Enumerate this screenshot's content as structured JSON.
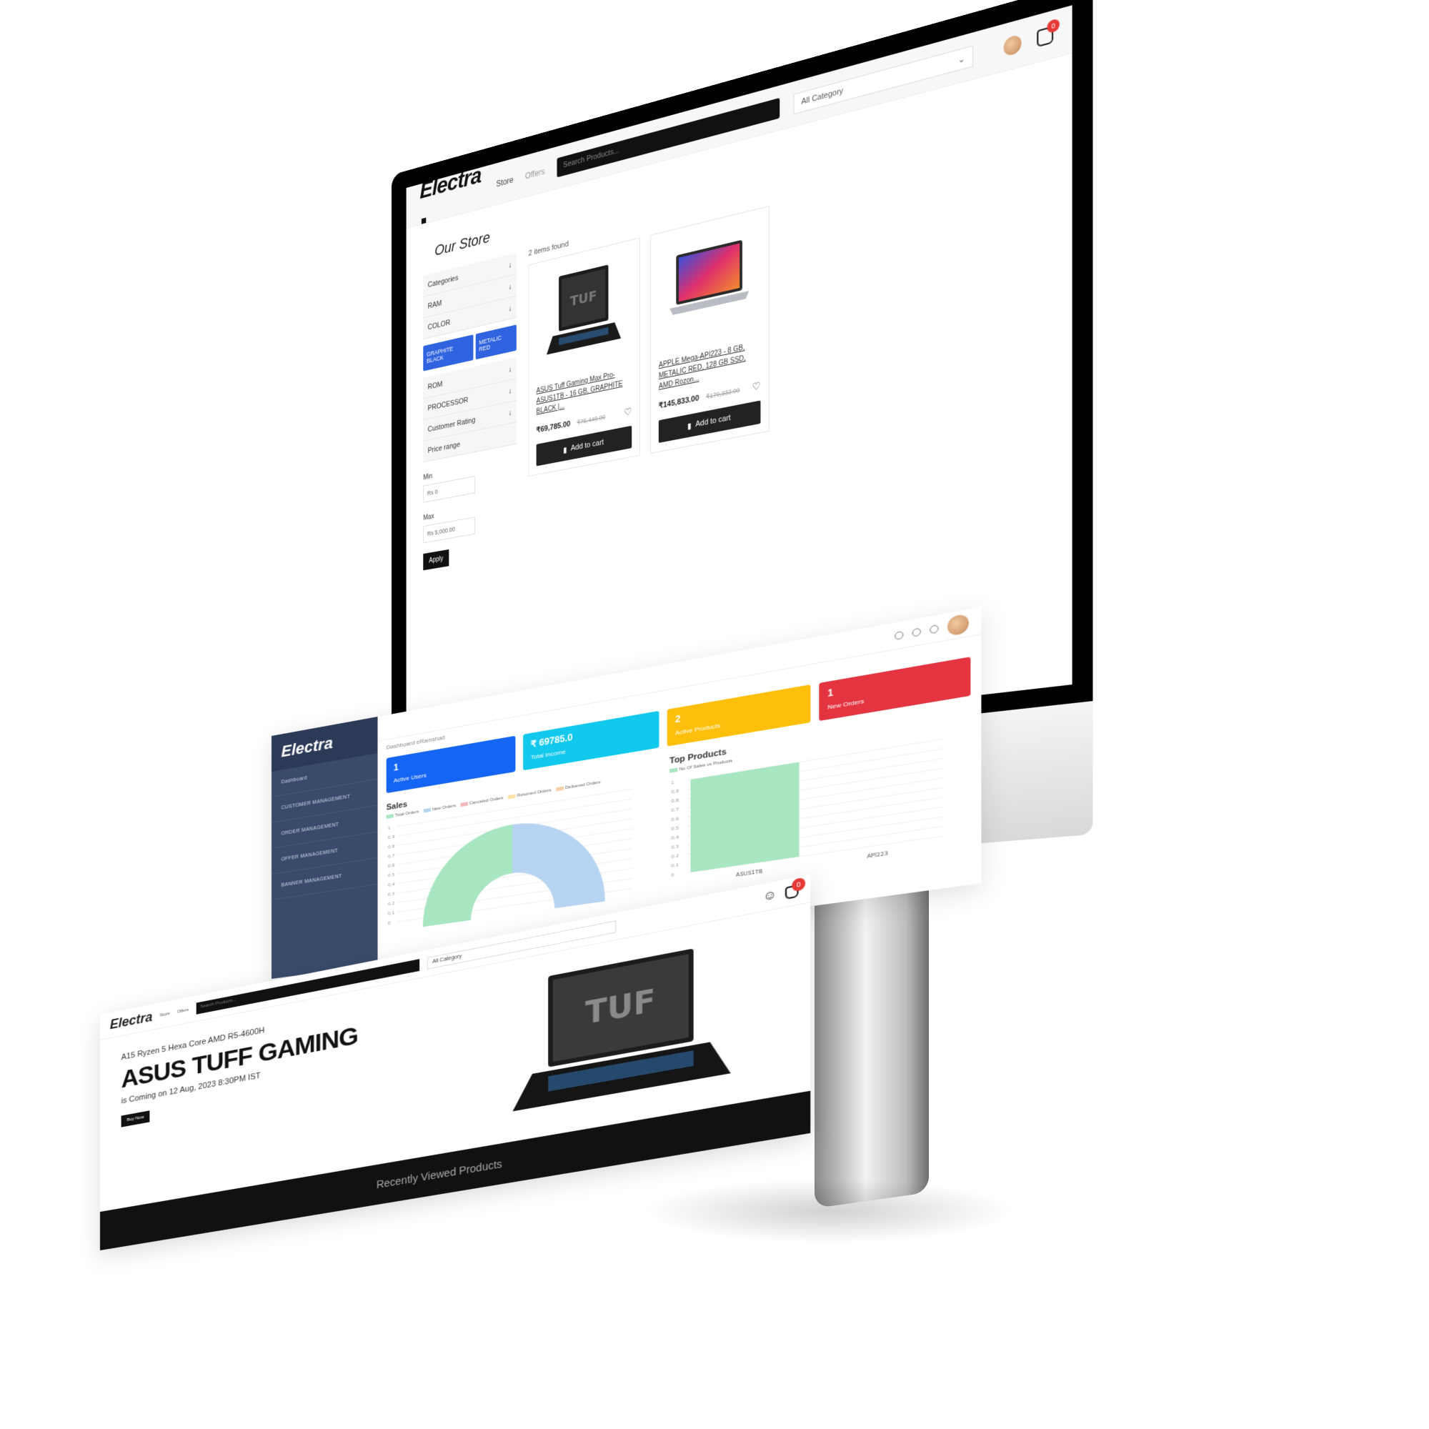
{
  "store": {
    "brand": "Electra",
    "nav": [
      "Store",
      "Offers"
    ],
    "search_placeholder": "Search Products...",
    "category": "All Category",
    "cart_count": "0",
    "page_title": "Our Store",
    "filters": {
      "items_top": [
        "Categories",
        "RAM",
        "COLOR"
      ],
      "chips": [
        "GRAPHITE BLACK",
        "METALIC RED"
      ],
      "items_bottom": [
        "ROM",
        "PROCESSOR",
        "Customer Rating",
        "Price range"
      ],
      "min_label": "Min",
      "min_placeholder": "Rs 0",
      "max_label": "Max",
      "max_placeholder": "Rs 5,000.00",
      "apply": "Apply"
    },
    "results_count": "2 items found",
    "products": [
      {
        "name": "ASUS Tuff Gaming Max Pro-ASUS1TB - 16 GB, GRAPHITE BLACK |...",
        "price": "₹69,785.00",
        "old_price": "₹75,449.00",
        "button": "Add to cart"
      },
      {
        "name": "APPLE Mega-API223 - 8 GB, METALIC RED, 128 GB SSD, AMD Rozon...",
        "price": "₹145,833.00",
        "old_price": "₹179,333.00",
        "button": "Add to cart"
      }
    ]
  },
  "admin": {
    "brand": "Electra",
    "breadcrumb": "Dashboard   eRamshad",
    "menu": [
      "Dashboard",
      "CUSTOMER MANAGEMENT",
      "ORDER MANAGEMENT",
      "OFFER MANAGEMENT",
      "BANNER MANAGEMENT"
    ],
    "cards": [
      {
        "value": "1",
        "label": "Active Users",
        "color": "#1565f5"
      },
      {
        "value": "₹ 69785.0",
        "label": "Total Income",
        "color": "#12c8ec"
      },
      {
        "value": "2",
        "label": "Active Products",
        "color": "#fdbf0c"
      },
      {
        "value": "1",
        "label": "New Orders",
        "color": "#e3343f"
      }
    ],
    "sales_title": "Sales",
    "sales_legend": [
      "Total Orders",
      "New Orders",
      "Canceled Orders",
      "Returned Orders",
      "Delivered Orders"
    ],
    "top_products_title": "Top Products",
    "top_legend": "No Of Sales vs Products",
    "y_ticks": [
      "1",
      "0.9",
      "0.8",
      "0.7",
      "0.6",
      "0.5",
      "0.4",
      "0.3",
      "0.2",
      "0.1",
      "0"
    ],
    "x_labels": [
      "ASUS1TB",
      "API223"
    ]
  },
  "home": {
    "brand": "Electra",
    "nav": [
      "Store",
      "Offers"
    ],
    "search_placeholder": "Search Products...",
    "category": "All Category",
    "cart_count": "0",
    "banner_sub": "A15 Ryzen 5 Hexa Core AMD R5-4600H",
    "banner_title": "ASUS TUFF GAMING",
    "banner_date": "is Coming on 12 Aug, 2023 8:30PM IST",
    "banner_btn": "Buy Now",
    "recent_title": "Recently Viewed Products"
  },
  "chart_data": [
    {
      "type": "pie",
      "title": "Sales",
      "categories": [
        "Total Orders",
        "New Orders",
        "Canceled Orders",
        "Returned Orders",
        "Delivered Orders"
      ],
      "values": [
        1,
        1,
        0,
        0,
        0
      ]
    },
    {
      "type": "bar",
      "title": "Top Products",
      "categories": [
        "ASUS1TB",
        "API223"
      ],
      "series": [
        {
          "name": "No Of Sales vs Products",
          "values": [
            1,
            0
          ]
        }
      ],
      "ylim": [
        0,
        1
      ]
    }
  ]
}
